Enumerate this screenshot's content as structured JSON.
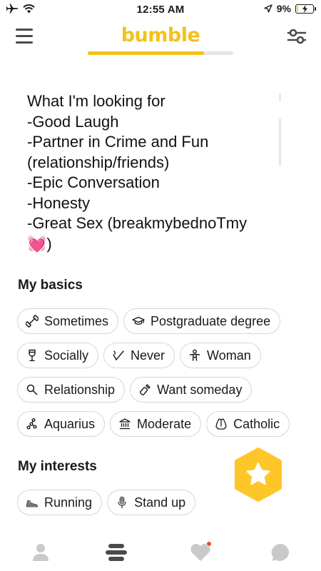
{
  "status_bar": {
    "time": "12:55 AM",
    "battery_percent": "9%",
    "battery_level": 0.09
  },
  "header": {
    "logo": "bumble",
    "progress_fraction": 0.8
  },
  "bio": {
    "lines": [
      "What I'm looking for",
      "-Good Laugh",
      "-Partner in Crime and Fun",
      "(relationship/friends)",
      "-Epic Conversation",
      "-Honesty",
      "-Great Sex (breakmybednoTmy",
      "💓)"
    ]
  },
  "basics": {
    "title": "My basics",
    "chips": [
      {
        "icon": "dumbbell-icon",
        "label": "Sometimes"
      },
      {
        "icon": "graduation-cap-icon",
        "label": "Postgraduate degree"
      },
      {
        "icon": "wine-glass-icon",
        "label": "Socially"
      },
      {
        "icon": "cigarette-icon",
        "label": "Never"
      },
      {
        "icon": "person-icon",
        "label": "Woman"
      },
      {
        "icon": "search-icon",
        "label": "Relationship"
      },
      {
        "icon": "baby-bottle-icon",
        "label": "Want someday"
      },
      {
        "icon": "constellation-icon",
        "label": "Aquarius"
      },
      {
        "icon": "government-building-icon",
        "label": "Moderate"
      },
      {
        "icon": "praying-hands-icon",
        "label": "Catholic"
      }
    ]
  },
  "interests": {
    "title": "My interests",
    "chips": [
      {
        "icon": "running-shoe-emoji",
        "label": "Running"
      },
      {
        "icon": "microphone-emoji",
        "label": "Stand up"
      }
    ]
  },
  "bottom_nav": {
    "items": [
      "profile-icon",
      "people-stack-icon",
      "heart-icon",
      "chat-bubble-icon"
    ]
  },
  "colors": {
    "brand_yellow": "#f5c118",
    "hex_button_yellow": "#ffc629",
    "notification_red": "#e8492f",
    "inactive_gray": "#c9c9c9"
  }
}
